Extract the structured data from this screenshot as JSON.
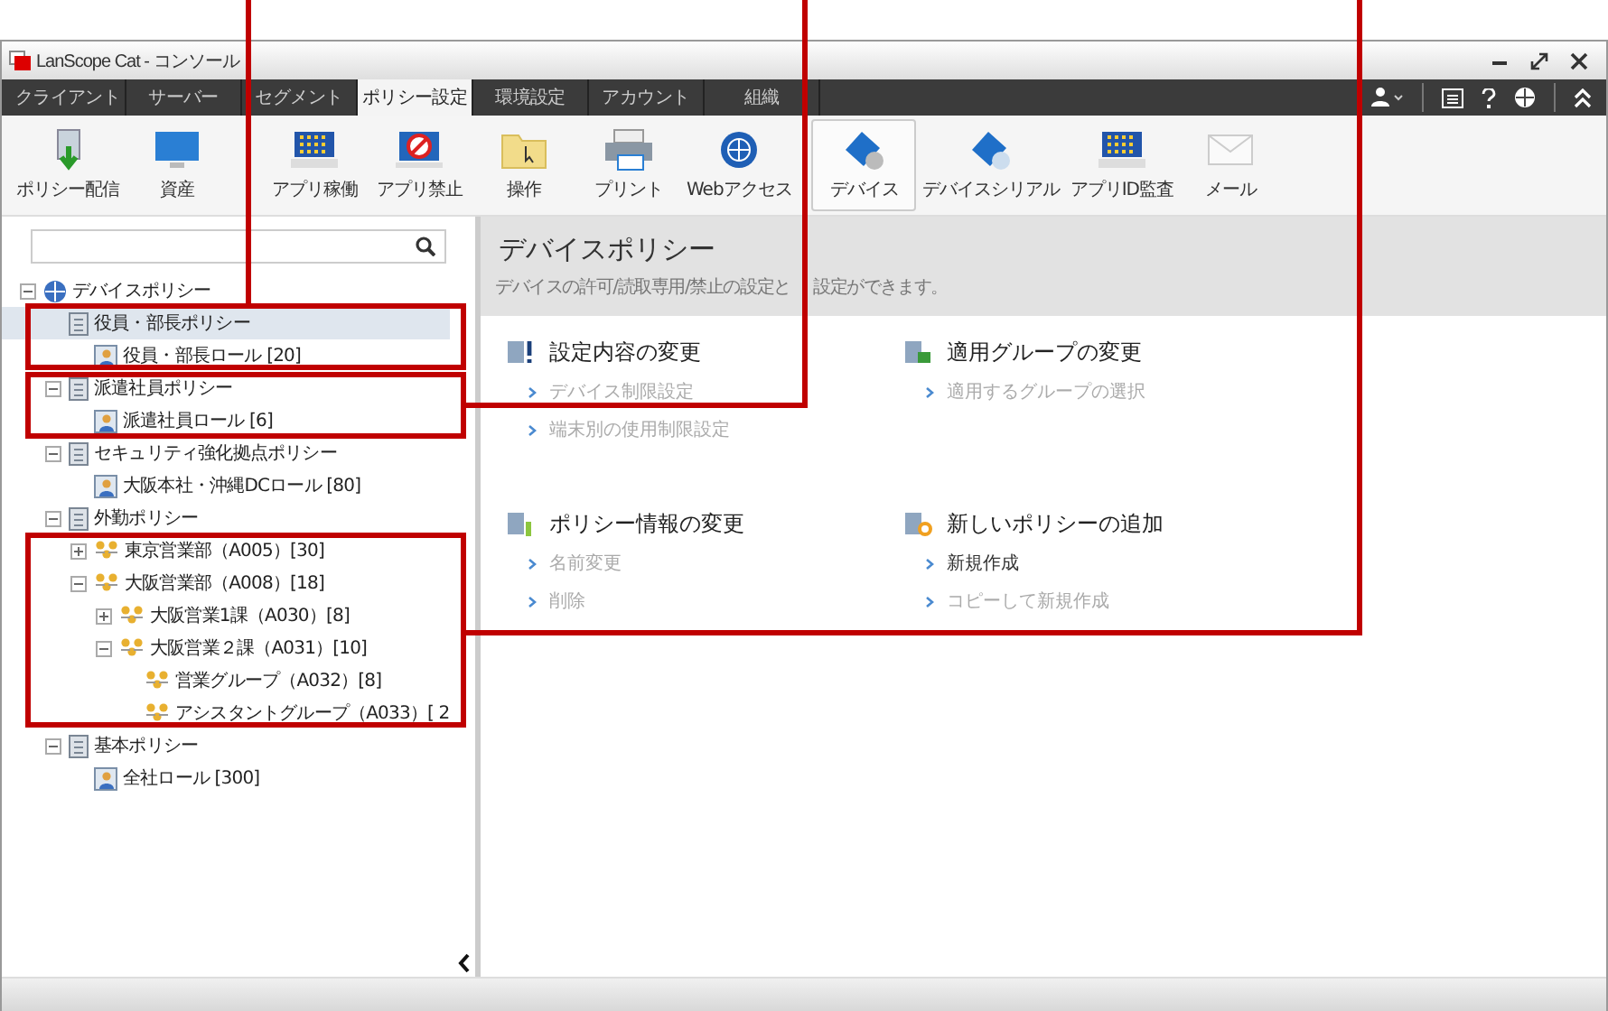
{
  "window": {
    "title": "LanScope Cat - コンソール"
  },
  "tabs": [
    {
      "label": "クライアント",
      "selected": false
    },
    {
      "label": "サーバー",
      "selected": false
    },
    {
      "label": "セグメント",
      "selected": false
    },
    {
      "label": "ポリシー設定",
      "selected": true
    },
    {
      "label": "環境設定",
      "selected": false
    },
    {
      "label": "アカウント",
      "selected": false
    },
    {
      "label": "組織",
      "selected": false
    }
  ],
  "toolbar": [
    {
      "label": "ポリシー配信",
      "selected": false
    },
    {
      "label": "資産",
      "selected": false
    },
    {
      "label": "アプリ稼働",
      "selected": false
    },
    {
      "label": "アプリ禁止",
      "selected": false
    },
    {
      "label": "操作",
      "selected": false
    },
    {
      "label": "プリント",
      "selected": false
    },
    {
      "label": "Webアクセス",
      "selected": false
    },
    {
      "label": "デバイス",
      "selected": true
    },
    {
      "label": "デバイスシリアル",
      "selected": false
    },
    {
      "label": "アプリID監査",
      "selected": false
    },
    {
      "label": "メール",
      "selected": false
    }
  ],
  "tree": [
    {
      "label": "デバイスポリシー",
      "kind": "root",
      "selected": false,
      "expanded": true,
      "children": [
        {
          "label": "役員・部長ポリシー",
          "kind": "policy",
          "selected": true,
          "children": [
            {
              "label": "役員・部長ロール [20]",
              "kind": "role",
              "selected": false
            }
          ]
        },
        {
          "label": "派遣社員ポリシー",
          "kind": "policy",
          "selected": false,
          "expanded": true,
          "children": [
            {
              "label": "派遣社員ロール [6]",
              "kind": "role",
              "selected": false
            }
          ]
        },
        {
          "label": "セキュリティ強化拠点ポリシー",
          "kind": "policy",
          "selected": false,
          "expanded": true,
          "children": [
            {
              "label": "大阪本社・沖縄DCロール [80]",
              "kind": "role",
              "selected": false
            }
          ]
        },
        {
          "label": "外勤ポリシー",
          "kind": "policy",
          "selected": false,
          "expanded": true,
          "children": [
            {
              "label": "東京営業部（A005）[30]",
              "kind": "group",
              "selected": false,
              "expanded": false
            },
            {
              "label": "大阪営業部（A008）[18]",
              "kind": "group",
              "selected": false,
              "expanded": true,
              "children": [
                {
                  "label": "大阪営業1課（A030）[8]",
                  "kind": "group",
                  "selected": false,
                  "expanded": false
                },
                {
                  "label": "大阪営業２課（A031）[10]",
                  "kind": "group",
                  "selected": false,
                  "expanded": true,
                  "children": [
                    {
                      "label": "営業グループ（A032）[8]",
                      "kind": "group",
                      "selected": false
                    },
                    {
                      "label": "アシスタントグループ（A033）[ 2",
                      "kind": "group",
                      "selected": false
                    }
                  ]
                }
              ]
            }
          ]
        },
        {
          "label": "基本ポリシー",
          "kind": "policy",
          "selected": false,
          "expanded": true,
          "children": [
            {
              "label": "全社ロール [300]",
              "kind": "role",
              "selected": false
            }
          ]
        }
      ]
    }
  ],
  "panel": {
    "title": "デバイスポリシー",
    "description": [
      "デバイスの許可/読取専用/禁止の設定と",
      "設定ができます。"
    ],
    "sections": [
      {
        "title": "設定内容の変更",
        "links": [
          {
            "label": "デバイス制限設定",
            "disabled": true
          },
          {
            "label": "端末別の使用制限設定",
            "disabled": true
          }
        ]
      },
      {
        "title": "適用グループの変更",
        "links": [
          {
            "label": "適用するグループの選択",
            "disabled": true
          }
        ]
      },
      {
        "title": "ポリシー情報の変更",
        "links": [
          {
            "label": "名前変更",
            "disabled": true
          },
          {
            "label": "削除",
            "disabled": true
          }
        ]
      },
      {
        "title": "新しいポリシーの追加",
        "links": [
          {
            "label": "新規作成",
            "disabled": false
          },
          {
            "label": "コピーして新規作成",
            "disabled": true
          }
        ]
      }
    ]
  }
}
